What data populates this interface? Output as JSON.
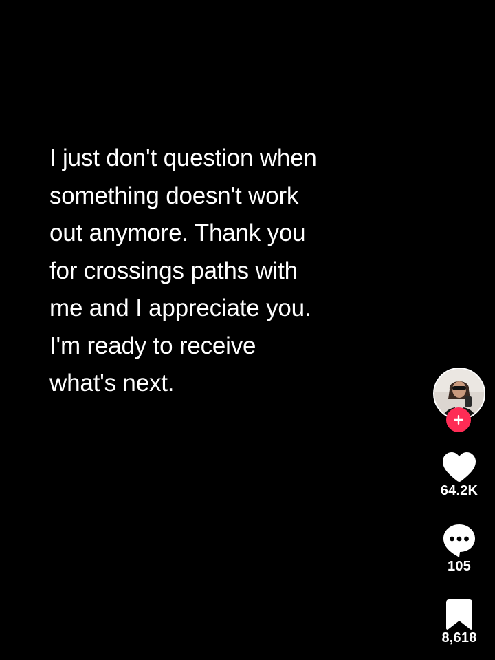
{
  "caption": {
    "lines": [
      "I just don't question when",
      "something doesn't work",
      "out anymore. Thank you",
      "for crossings paths with",
      "me and I appreciate you.",
      "I'm ready to receive",
      "what's next."
    ]
  },
  "actions": {
    "profile": {
      "avatar_icon": "profile-avatar",
      "follow_icon": "plus-icon",
      "follow_color": "#fe2c55"
    },
    "like": {
      "icon": "heart-icon",
      "count": "64.2K"
    },
    "comment": {
      "icon": "comment-bubble-icon",
      "count": "105"
    },
    "save": {
      "icon": "bookmark-icon",
      "count": "8,618"
    }
  },
  "colors": {
    "background": "#000000",
    "text": "#ffffff",
    "accent": "#fe2c55"
  }
}
